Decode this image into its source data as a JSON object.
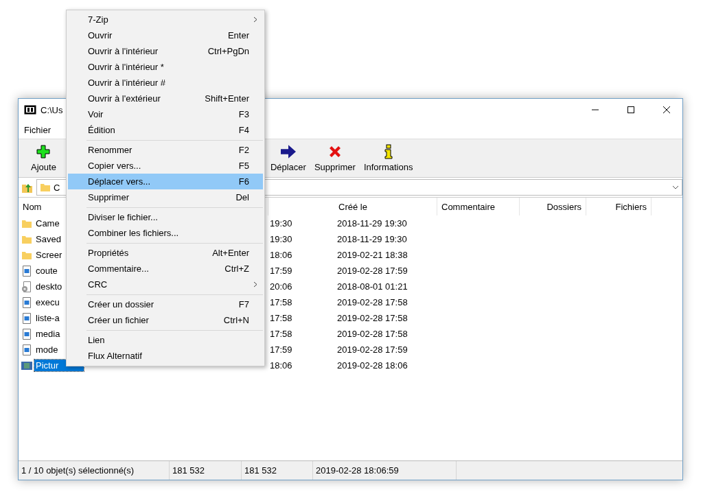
{
  "window": {
    "title": "C:\\Us"
  },
  "menu_bar": [
    "Fichier"
  ],
  "toolbar": [
    {
      "kind": "add",
      "label": "Ajoute"
    },
    {
      "kind": "move",
      "label": "Déplacer"
    },
    {
      "kind": "delete",
      "label": "Supprimer"
    },
    {
      "kind": "info",
      "label": "Informations"
    }
  ],
  "address_bar": {
    "value": "C"
  },
  "file_list": {
    "columns": [
      "Nom",
      "Créé le",
      "Commentaire",
      "Dossiers",
      "Fichiers"
    ],
    "rows": [
      {
        "kind": "folder",
        "name": "Came",
        "column_2": "19:30",
        "created": "2018-11-29 19:30",
        "selected": false
      },
      {
        "kind": "folder",
        "name": "Saved",
        "column_2": "19:30",
        "created": "2018-11-29 19:30",
        "selected": false
      },
      {
        "kind": "folder",
        "name": "Screer",
        "column_2": "18:06",
        "created": "2019-02-21 18:38",
        "selected": false
      },
      {
        "kind": "image",
        "name": "coute",
        "column_2": "17:59",
        "created": "2019-02-28 17:59",
        "selected": false
      },
      {
        "kind": "system",
        "name": "deskto",
        "column_2": "20:06",
        "created": "2018-08-01 01:21",
        "selected": false
      },
      {
        "kind": "image",
        "name": "execu",
        "column_2": "17:58",
        "created": "2019-02-28 17:58",
        "selected": false
      },
      {
        "kind": "image",
        "name": "liste-a",
        "column_2": "17:58",
        "created": "2019-02-28 17:58",
        "selected": false
      },
      {
        "kind": "image",
        "name": "media",
        "column_2": "17:58",
        "created": "2019-02-28 17:58",
        "selected": false
      },
      {
        "kind": "image",
        "name": "mode",
        "column_2": "17:59",
        "created": "2019-02-28 17:59",
        "selected": false
      },
      {
        "kind": "picture",
        "name": "Pictur",
        "column_2": "18:06",
        "created": "2019-02-28 18:06",
        "selected": true
      }
    ]
  },
  "context_menu": [
    {
      "kind": "item",
      "label": "7-Zip",
      "submenu": true,
      "selected": false
    },
    {
      "kind": "item",
      "label": "Ouvrir",
      "shortcut": "Enter",
      "submenu": false,
      "selected": false
    },
    {
      "kind": "item",
      "label": "Ouvrir à l'intérieur",
      "shortcut": "Ctrl+PgDn",
      "submenu": false,
      "selected": false
    },
    {
      "kind": "item",
      "label": "Ouvrir à l'intérieur *",
      "submenu": false,
      "selected": false
    },
    {
      "kind": "item",
      "label": "Ouvrir à l'intérieur #",
      "submenu": false,
      "selected": false
    },
    {
      "kind": "item",
      "label": "Ouvrir à l'extérieur",
      "shortcut": "Shift+Enter",
      "submenu": false,
      "selected": false
    },
    {
      "kind": "item",
      "label": "Voir",
      "shortcut": "F3",
      "submenu": false,
      "selected": false
    },
    {
      "kind": "item",
      "label": "Édition",
      "shortcut": "F4",
      "submenu": false,
      "selected": false
    },
    {
      "kind": "separator"
    },
    {
      "kind": "item",
      "label": "Renommer",
      "shortcut": "F2",
      "submenu": false,
      "selected": false
    },
    {
      "kind": "item",
      "label": "Copier vers...",
      "shortcut": "F5",
      "submenu": false,
      "selected": false
    },
    {
      "kind": "item",
      "label": "Déplacer vers...",
      "shortcut": "F6",
      "submenu": false,
      "selected": true
    },
    {
      "kind": "item",
      "label": "Supprimer",
      "shortcut": "Del",
      "submenu": false,
      "selected": false
    },
    {
      "kind": "separator"
    },
    {
      "kind": "item",
      "label": "Diviser le fichier...",
      "submenu": false,
      "selected": false
    },
    {
      "kind": "item",
      "label": "Combiner les fichiers...",
      "submenu": false,
      "selected": false
    },
    {
      "kind": "separator"
    },
    {
      "kind": "item",
      "label": "Propriétés",
      "shortcut": "Alt+Enter",
      "submenu": false,
      "selected": false
    },
    {
      "kind": "item",
      "label": "Commentaire...",
      "shortcut": "Ctrl+Z",
      "submenu": false,
      "selected": false
    },
    {
      "kind": "item",
      "label": "CRC",
      "submenu": true,
      "selected": false
    },
    {
      "kind": "separator"
    },
    {
      "kind": "item",
      "label": "Créer un dossier",
      "shortcut": "F7",
      "submenu": false,
      "selected": false
    },
    {
      "kind": "item",
      "label": "Créer un fichier",
      "shortcut": "Ctrl+N",
      "submenu": false,
      "selected": false
    },
    {
      "kind": "separator"
    },
    {
      "kind": "item",
      "label": "Lien",
      "submenu": false,
      "selected": false
    },
    {
      "kind": "item",
      "label": "Flux Alternatif",
      "submenu": false,
      "selected": false
    }
  ],
  "status_bar": [
    "1 / 10 objet(s) sélectionné(s)",
    "181 532",
    "181 532",
    "2019-02-28 18:06:59"
  ]
}
